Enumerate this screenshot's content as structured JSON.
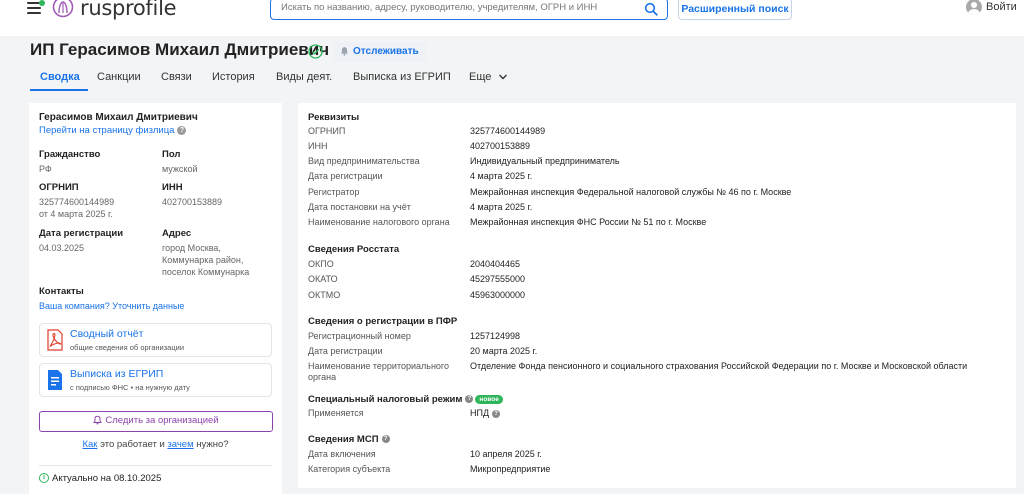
{
  "header": {
    "logo_text": "rusprofile",
    "search_placeholder": "Искать по названию, адресу, руководителю, учредителям, ОГРН и ИНН",
    "advanced_search": "Расширенный поиск",
    "login": "Войти"
  },
  "title": {
    "name": "ИП Герасимов Михаил Дмитриевич",
    "watch": "Отслеживать"
  },
  "tabs": [
    "Сводка",
    "Санкции",
    "Связи",
    "История",
    "Виды деят.",
    "Выписка из ЕГРИП",
    "Еще"
  ],
  "left": {
    "person_name": "Герасимов Михаил Дмитриевич",
    "fiz_link": "Перейти на страницу физлица",
    "citizenship_label": "Гражданство",
    "citizenship_value": "РФ",
    "gender_label": "Пол",
    "gender_value": "мужской",
    "ogrnip_label": "ОГРНИП",
    "ogrnip_value": "325774600144989",
    "ogrnip_date": "от 4 марта 2025 г.",
    "inn_label": "ИНН",
    "inn_value": "402700153889",
    "regdate_label": "Дата регистрации",
    "regdate_value": "04.03.2025",
    "address_label": "Адрес",
    "address_line1": "город Москва,",
    "address_line2": "Коммунарка район,",
    "address_line3": "поселок Коммунарка",
    "contacts_label": "Контакты",
    "contacts_link": "Ваша компания? Уточнить данные",
    "report_title": "Сводный отчёт",
    "report_sub": "общие сведения об организации",
    "egrip_title": "Выписка из ЕГРИП",
    "egrip_sub": "с подписью ФНС • на нужную дату",
    "follow_btn": "Следить за организацией",
    "how_link": "Как",
    "how_mid": "это работает и",
    "why_link": "зачем",
    "how_end": "нужно?",
    "actual": "Актуально на 08.10.2025"
  },
  "right": {
    "requisites": {
      "title": "Реквизиты",
      "rows": [
        {
          "k": "ОГРНИП",
          "v": "325774600144989"
        },
        {
          "k": "ИНН",
          "v": "402700153889"
        },
        {
          "k": "Вид предпринимательства",
          "v": "Индивидуальный предприниматель"
        },
        {
          "k": "Дата регистрации",
          "v": "4 марта 2025 г."
        },
        {
          "k": "Регистратор",
          "v": "Межрайонная инспекция Федеральной налоговой службы № 46 по г. Москве"
        },
        {
          "k": "Дата постановки на учёт",
          "v": "4 марта 2025 г."
        },
        {
          "k": "Наименование налогового органа",
          "v": "Межрайонная инспекция ФНС России № 51 по г. Москве"
        }
      ]
    },
    "rosstat": {
      "title": "Сведения Росстата",
      "rows": [
        {
          "k": "ОКПО",
          "v": "2040404465"
        },
        {
          "k": "ОКАТО",
          "v": "45297555000"
        },
        {
          "k": "ОКТМО",
          "v": "45963000000"
        }
      ]
    },
    "pfr": {
      "title": "Сведения о регистрации в ПФР",
      "rows": [
        {
          "k": "Регистрационный номер",
          "v": "1257124998"
        },
        {
          "k": "Дата регистрации",
          "v": "20 марта 2025 г."
        }
      ],
      "org_k1": "Наименование территориального",
      "org_k2": "органа",
      "org_v": "Отделение Фонда пенсионного и социального страхования Российской Федерации по г. Москве и Московской области"
    },
    "tax": {
      "title": "Специальный налоговый режим",
      "badge": "новое",
      "k": "Применяется",
      "v": "НПД"
    },
    "msp": {
      "title": "Сведения МСП",
      "rows": [
        {
          "k": "Дата включения",
          "v": "10 апреля 2025 г."
        },
        {
          "k": "Категория субъекта",
          "v": "Микропредприятие"
        }
      ]
    }
  }
}
